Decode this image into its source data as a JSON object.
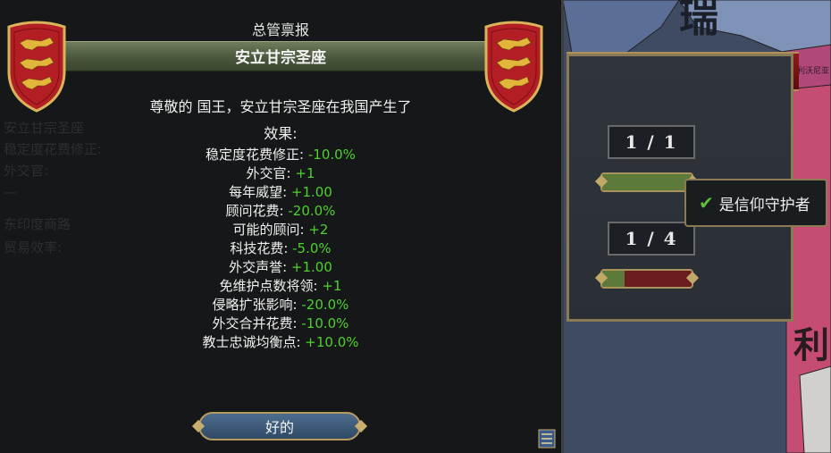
{
  "dialog": {
    "window_title": "总管禀报",
    "event_title": "安立甘宗圣座",
    "description": "尊敬的 国王，安立甘宗圣座在我国产生了",
    "effects_header": "效果:",
    "ok_label": "好的",
    "ghost_lines": [
      "安立甘宗圣座",
      "稳定度花费修正:",
      "外交官:",
      "—",
      "东印度商路",
      "贸易效率:"
    ]
  },
  "effects": [
    {
      "label": "稳定度花费修正: ",
      "value": "-10.0%"
    },
    {
      "label": "外交官: ",
      "value": "+1"
    },
    {
      "label": "每年威望: ",
      "value": "+1.00"
    },
    {
      "label": "顾问花费: ",
      "value": "-20.0%"
    },
    {
      "label": "可能的顾问: ",
      "value": "+2"
    },
    {
      "label": "科技花费: ",
      "value": "-5.0%"
    },
    {
      "label": "外交声誉: ",
      "value": "+1.00"
    },
    {
      "label": "免维护点数将领: ",
      "value": "+1"
    },
    {
      "label": "侵略扩张影响: ",
      "value": "-20.0%"
    },
    {
      "label": "外交合并花费: ",
      "value": "-10.0%"
    },
    {
      "label": "教士忠诚均衡点: ",
      "value": "+10.0%"
    }
  ],
  "side_panel": {
    "counter_1": "1 / 1",
    "counter_2": "1 / 4",
    "bar_1_fill": 1.0,
    "bar_2_fill": 0.25,
    "tooltip_text": "是信仰守护者"
  },
  "map": {
    "label_large_1": "瑞",
    "label_large_2": "利",
    "label_small": "利沃尼亚"
  },
  "colors": {
    "positive_value": "#4ed12e",
    "shield_red": "#b21e24",
    "lion_gold": "#e3b53a",
    "button_blue": "#3e5c7c"
  },
  "icons": [
    "coat-of-arms-england",
    "checkmark-icon",
    "ledger-icon"
  ]
}
